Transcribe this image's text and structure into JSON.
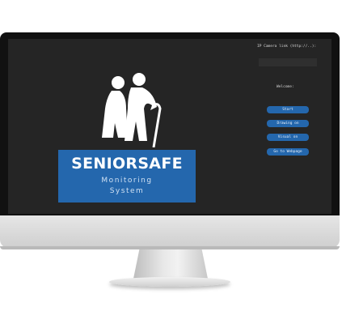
{
  "logo": {
    "title": "SENIORSAFE",
    "subtitle_line1": "Monitoring",
    "subtitle_line2": "System"
  },
  "controls": {
    "camera_label": "IP Camera link (http://..):",
    "camera_input_value": "",
    "welcome_text": "Welcome:",
    "buttons": {
      "start": "Start",
      "drawing": "Drawing on",
      "visual": "Visual on",
      "webpage": "Go to Webpage"
    }
  },
  "colors": {
    "screen_bg": "#252525",
    "accent_blue": "#2467ad"
  }
}
